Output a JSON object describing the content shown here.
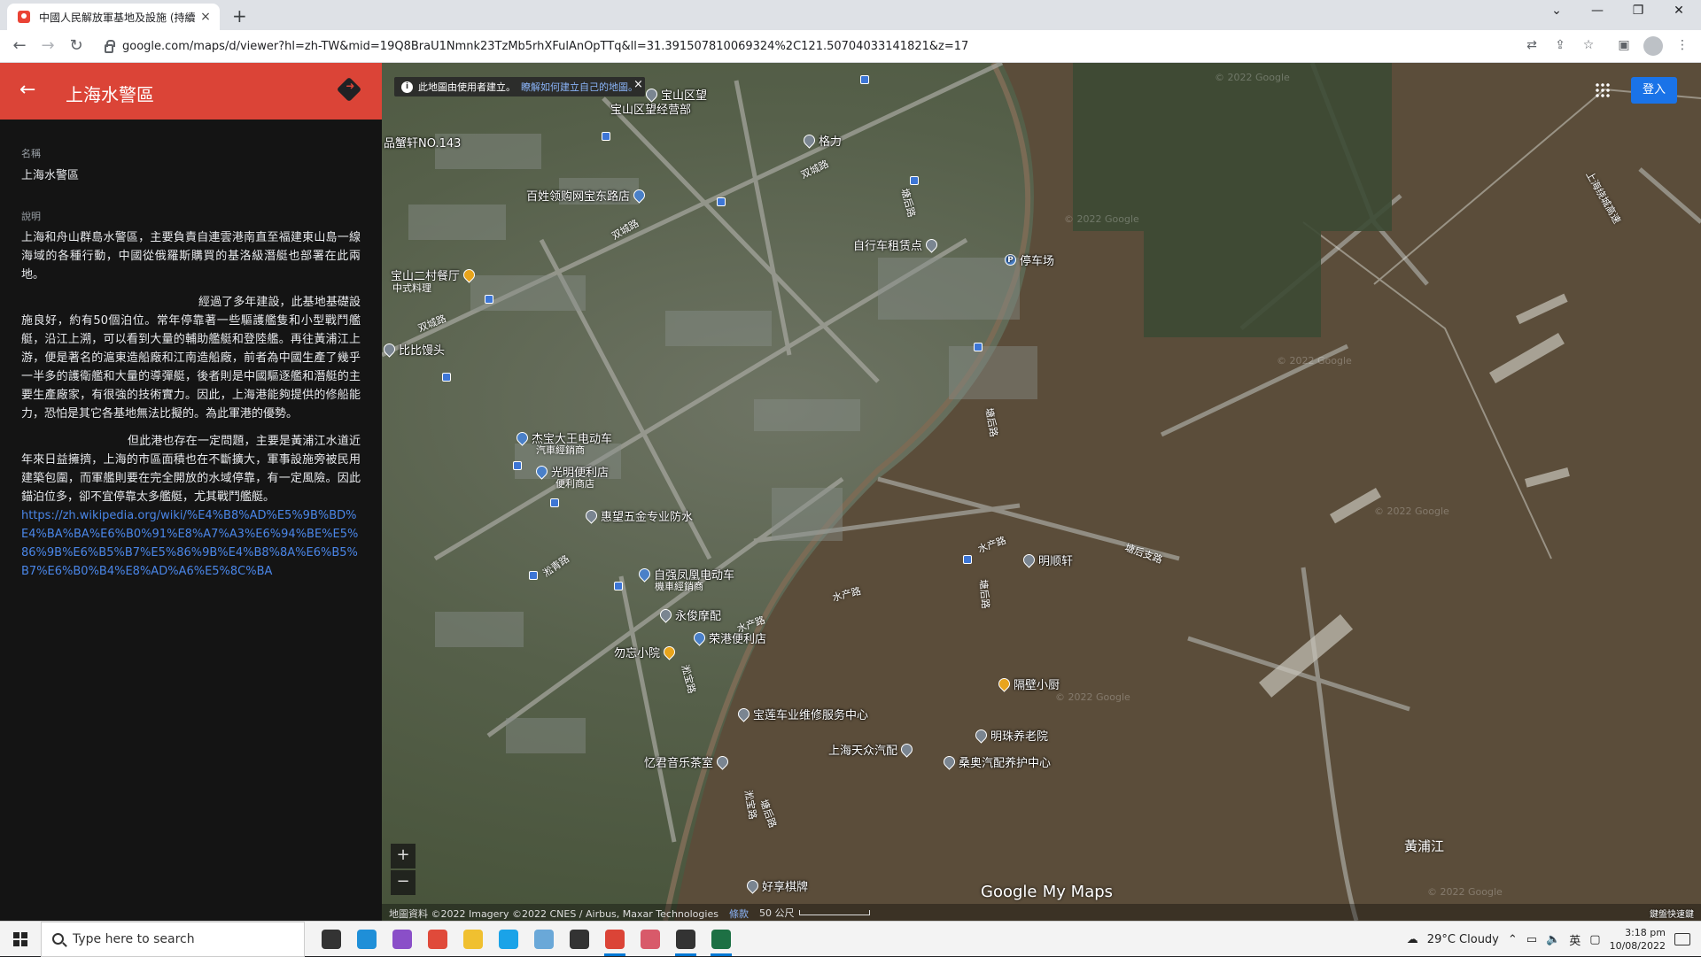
{
  "browser": {
    "tab_title": "中國人民解放軍基地及設施 (持續",
    "tab_close": "×",
    "new_tab": "+",
    "url": "google.com/maps/d/viewer?hl=zh-TW&mid=19Q8BraU1Nmnk23TzMb5rhXFulAnOpTTq&ll=31.391507810069324%2C121.50704033141821&z=17",
    "window_controls": [
      "⌄",
      "—",
      "❐",
      "✕"
    ]
  },
  "panel": {
    "title": "上海水警區",
    "name_label": "名稱",
    "name_value": "上海水警區",
    "desc_label": "說明",
    "desc_p1": "上海和舟山群島水警區，主要負責自連雲港南直至福建東山島一線海域的各種行動，中國從俄羅斯購買的基洛級潛艇也部署在此兩地。",
    "desc_p2": "經過了多年建設，此基地基礎設施良好，約有50個泊位。常年停靠著一些驅護艦隻和小型戰鬥艦艇，沿江上溯，可以看到大量的輔助艦艇和登陸艦。再往黃浦江上游，便是著名的滬東造船廠和江南造船廠，前者為中國生產了幾乎一半多的護衛艦和大量的導彈艇，後者則是中國驅逐艦和潛艇的主要生產廠家，有很強的技術實力。因此，上海港能夠提供的修船能力，恐怕是其它各基地無法比擬的。為此軍港的優勢。",
    "desc_p3": "但此港也存在一定問題，主要是黃浦江水道近年來日益擁擠，上海的市區面積也在不斷擴大，軍事設施旁被民用建築包圍，而軍艦則要在完全開放的水域停靠，有一定風險。因此錨泊位多，卻不宜停靠太多艦艇，尤其戰鬥艦艇。",
    "link": "https://zh.wikipedia.org/wiki/%E4%B8%AD%E5%9B%BD%E4%BA%BA%E6%B0%91%E8%A7%A3%E6%94%BE%E5%86%9B%E6%B5%B7%E5%86%9B%E4%B8%8A%E6%B5%B7%E6%B0%B4%E8%AD%A6%E5%8C%BA"
  },
  "map": {
    "banner_text": "此地圖由使用者建立。",
    "banner_link": "瞭解如何建立自己的地圖。",
    "banner_close": "×",
    "signin": "登入",
    "zoom_in": "+",
    "zoom_out": "−",
    "footer_data": "地圖資料 ©2022 Imagery ©2022 CNES / Airbus, Maxar Technologies",
    "footer_terms": "條款",
    "footer_scale": "50 公尺",
    "brand_google": "Google",
    "brand_mymaps": "My Maps",
    "watermark": "© 2022 Google",
    "shortcut": "鍵盤快速鍵",
    "river": "黃浦江",
    "pois": [
      {
        "name": "宝山区望",
        "color": "gray"
      },
      {
        "name": "宝山区望经营部",
        "color": "gray"
      },
      {
        "name": "品蟹轩NO.143",
        "color": "gray"
      },
      {
        "name": "格力",
        "color": "gray"
      },
      {
        "name": "百姓领购网宝东路店",
        "color": "blue"
      },
      {
        "name": "自行车租赁点",
        "color": "gray"
      },
      {
        "name": "停车场",
        "color": "parking"
      },
      {
        "name": "宝山二村餐厅",
        "color": "orange"
      },
      {
        "name": "比比馒头",
        "color": "gray"
      },
      {
        "name": "杰宝大王电动车",
        "color": "blue"
      },
      {
        "name": "光明便利店",
        "color": "blue"
      },
      {
        "name": "惠望五金专业防水",
        "color": "gray"
      },
      {
        "name": "自强凤凰电动车",
        "color": "blue"
      },
      {
        "name": "永俊摩配",
        "color": "gray"
      },
      {
        "name": "荣港便利店",
        "color": "blue"
      },
      {
        "name": "勿忘小院",
        "color": "orange"
      },
      {
        "name": "宝莲车业维修服务中心",
        "color": "gray"
      },
      {
        "name": "忆君音乐茶室",
        "color": "gray"
      },
      {
        "name": "上海天众汽配",
        "color": "gray"
      },
      {
        "name": "桑奥汽配养护中心",
        "color": "gray"
      },
      {
        "name": "明珠养老院",
        "color": "gray"
      },
      {
        "name": "隔壁小厨",
        "color": "orange"
      },
      {
        "name": "明顺轩",
        "color": "gray"
      },
      {
        "name": "好享棋牌",
        "color": "gray"
      }
    ],
    "sub_labels": [
      "中式料理",
      "汽車經銷商",
      "便利商店",
      "機車經銷商"
    ],
    "roads": [
      "双城路",
      "双城路",
      "双城路",
      "塘后路",
      "塘后路",
      "水产路",
      "水产路",
      "水产路",
      "淞青路",
      "淞宝路",
      "淞宝路",
      "塘后支路",
      "塘后路",
      "塘后路",
      "上海绕城高速"
    ]
  },
  "taskbar": {
    "search_placeholder": "Type here to search",
    "weather": "29°C  Cloudy",
    "lang": "英",
    "time": "3:18 pm",
    "date": "10/08/2022",
    "apps": [
      {
        "name": "task-view",
        "color": "#333333"
      },
      {
        "name": "edge",
        "color": "#1f8fd8"
      },
      {
        "name": "visual-studio",
        "color": "#8a4fc8"
      },
      {
        "name": "anydesk",
        "color": "#e04a3a"
      },
      {
        "name": "file-explorer",
        "color": "#f0c030"
      },
      {
        "name": "skype",
        "color": "#1aa3e8"
      },
      {
        "name": "notes",
        "color": "#6aa8d8"
      },
      {
        "name": "terminal",
        "color": "#333333"
      },
      {
        "name": "chrome",
        "color": "#db4437"
      },
      {
        "name": "snipping",
        "color": "#d85a6a"
      },
      {
        "name": "sticky",
        "color": "#333333"
      },
      {
        "name": "excel",
        "color": "#1d7044"
      }
    ]
  }
}
